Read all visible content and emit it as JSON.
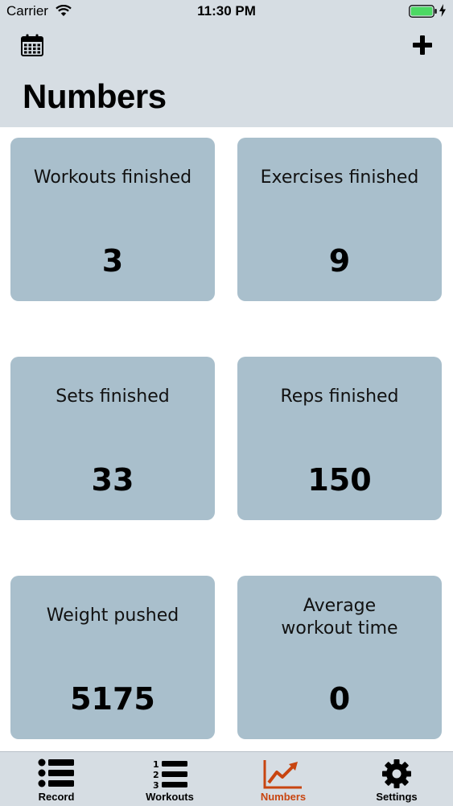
{
  "status": {
    "carrier": "Carrier",
    "time": "11:30 PM"
  },
  "header": {
    "title": "Numbers",
    "left_icon": "calendar-icon",
    "right_icon": "plus-icon"
  },
  "cards": [
    {
      "label": "Workouts finished",
      "value": "3"
    },
    {
      "label": "Exercises finished",
      "value": "9"
    },
    {
      "label": "Sets finished",
      "value": "33"
    },
    {
      "label": "Reps finished",
      "value": "150"
    },
    {
      "label": "Weight pushed",
      "value": "5175"
    },
    {
      "label": "Average workout time",
      "value": "0"
    }
  ],
  "tabs": [
    {
      "label": "Record",
      "icon": "list-icon"
    },
    {
      "label": "Workouts",
      "icon": "numbered-list-icon"
    },
    {
      "label": "Numbers",
      "icon": "chart-icon",
      "active": true
    },
    {
      "label": "Settings",
      "icon": "gear-icon"
    }
  ],
  "colors": {
    "header_bg": "#d6dde3",
    "card_bg": "#a9bfcc",
    "active_tab": "#c84510",
    "battery": "#4cd964"
  }
}
